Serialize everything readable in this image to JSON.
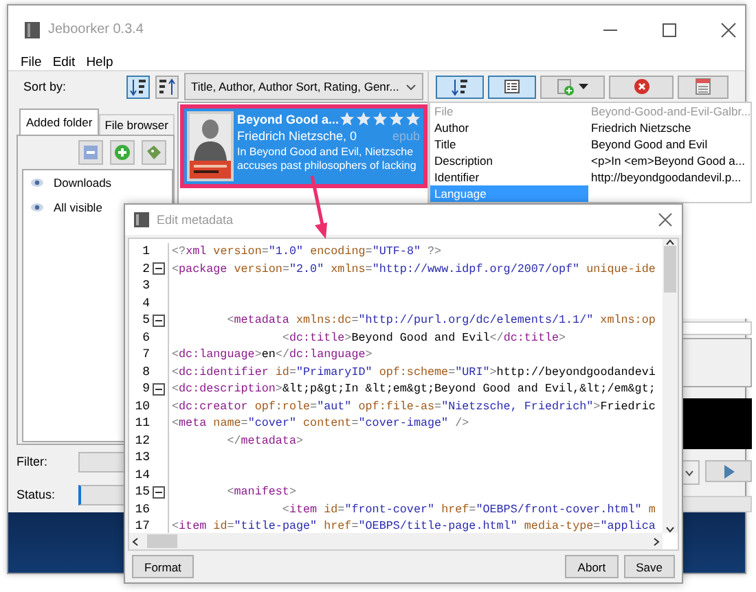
{
  "window": {
    "title": "Jeboorker 0.3.4"
  },
  "menu": [
    "File",
    "Edit",
    "Help"
  ],
  "sort": {
    "label": "Sort by:",
    "field": "Title, Author, Author Sort, Rating, Genr..."
  },
  "tabs": [
    {
      "label": "Added folder",
      "selected": true
    },
    {
      "label": "File browser",
      "selected": false
    }
  ],
  "folders": [
    {
      "label": "Downloads"
    },
    {
      "label": "All visible"
    }
  ],
  "books": [
    {
      "title": "Beyond Good a...",
      "author": "Friedrich Nietzsche, 0",
      "format": "epub",
      "description": "In Beyond Good and Evil, Nietzsche accuses past philosophers of lacking",
      "stars": 5,
      "selected": true
    }
  ],
  "properties": [
    {
      "name": "File",
      "value": "Beyond-Good-and-Evil-Galbr...",
      "disabled": true,
      "selected": false
    },
    {
      "name": "Author",
      "value": "Friedrich Nietzsche",
      "disabled": false,
      "selected": false
    },
    {
      "name": "Title",
      "value": "Beyond Good and Evil",
      "disabled": false,
      "selected": false
    },
    {
      "name": "Description",
      "value": "<p>In <em>Beyond Good a...",
      "disabled": false,
      "selected": false
    },
    {
      "name": "Identifier",
      "value": "http://beyondgoodandevil.p...",
      "disabled": false,
      "selected": false
    },
    {
      "name": "Language",
      "disabled": false,
      "selected": true
    }
  ],
  "filter": {
    "label": "Filter:"
  },
  "status": {
    "label": "Status:"
  },
  "dialog": {
    "title": "Edit metadata",
    "lines": [
      {
        "number": "1",
        "text": "<?xml version=\"1.0\" encoding=\"UTF-8\" ?>",
        "foldable": false
      },
      {
        "number": "2",
        "text": "<package version=\"2.0\" xmlns=\"http://www.idpf.org/2007/opf\" unique-ide",
        "foldable": true
      },
      {
        "number": "3",
        "foldable": false
      },
      {
        "number": "4",
        "foldable": false
      },
      {
        "number": "5",
        "text": "        <metadata xmlns:dc=\"http://purl.org/dc/elements/1.1/\" xmlns:op",
        "foldable": true
      },
      {
        "number": "6",
        "text": "                <dc:title>Beyond Good and Evil</dc:title>",
        "foldable": false
      },
      {
        "number": "7",
        "text": "<dc:language>en</dc:language>",
        "foldable": false
      },
      {
        "number": "8",
        "text": "<dc:identifier id=\"PrimaryID\" opf:scheme=\"URI\">http://beyondgoodandevi",
        "foldable": false
      },
      {
        "number": "9",
        "text": "<dc:description>&lt;p&gt;In &lt;em&gt;Beyond Good and Evil,&lt;/em&gt;",
        "foldable": true
      },
      {
        "number": "10",
        "text": "<dc:creator opf:role=\"aut\" opf:file-as=\"Nietzsche, Friedrich\">Friedric",
        "foldable": false
      },
      {
        "number": "11",
        "text": "<meta name=\"cover\" content=\"cover-image\" />",
        "foldable": false
      },
      {
        "number": "12",
        "text": "        </metadata>",
        "foldable": false
      },
      {
        "number": "13",
        "foldable": false
      },
      {
        "number": "14",
        "foldable": false
      },
      {
        "number": "15",
        "text": "        <manifest>",
        "foldable": true
      },
      {
        "number": "16",
        "text": "                <item id=\"front-cover\" href=\"OEBPS/front-cover.html\" m",
        "foldable": false
      },
      {
        "number": "17",
        "text": "<item id=\"title-page\" href=\"OEBPS/title-page.html\" media-type=\"applica",
        "foldable": false
      }
    ],
    "buttons": [
      {
        "label": "Format"
      },
      {
        "label": "Abort"
      },
      {
        "label": "Save"
      }
    ]
  }
}
